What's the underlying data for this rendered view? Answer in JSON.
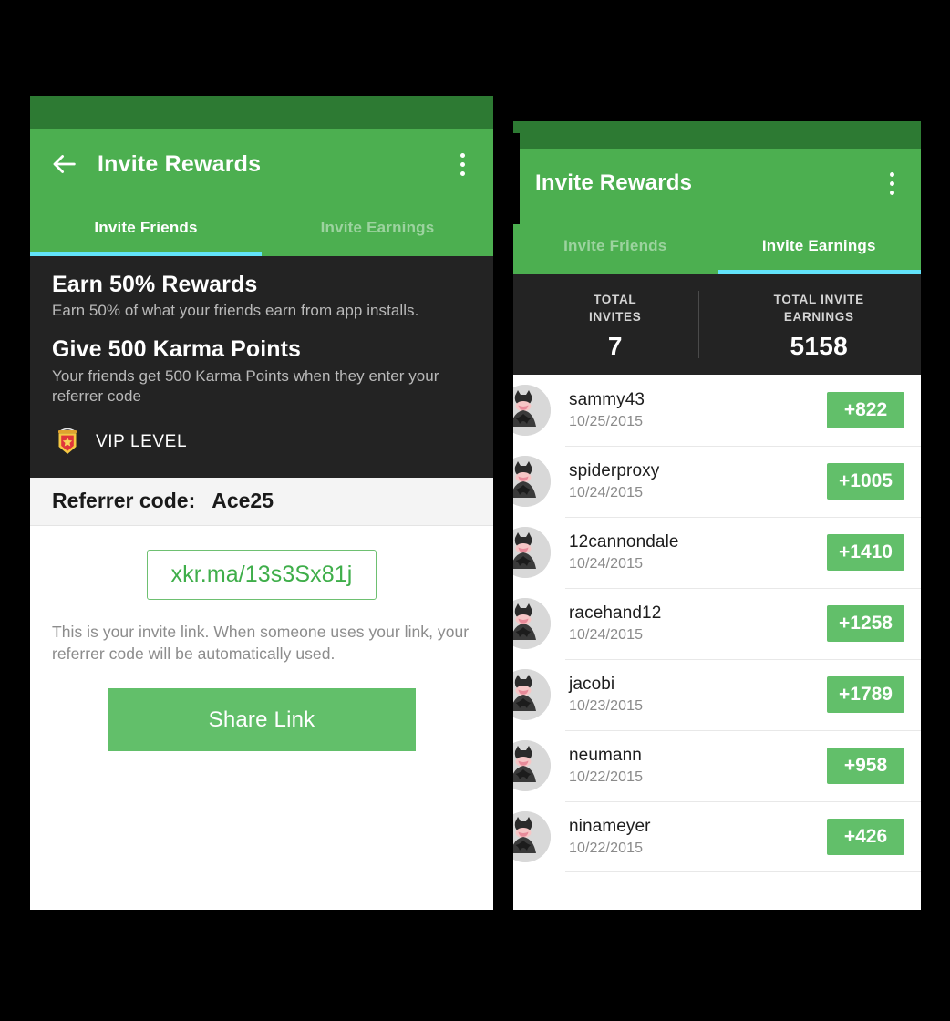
{
  "left_phone": {
    "appbar": {
      "back_icon": "arrow-left-icon",
      "title": "Invite Rewards",
      "overflow_icon": "overflow-menu-icon"
    },
    "tabs": [
      {
        "label": "Invite Friends",
        "active": true
      },
      {
        "label": "Invite Earnings",
        "active": false
      }
    ],
    "promo": {
      "heading_1": "Earn 50% Rewards",
      "body_1": "Earn 50% of what your friends earn from app installs.",
      "heading_2": "Give 500 Karma Points",
      "body_2": "Your friends get 500 Karma Points when they enter your referrer code",
      "vip_icon": "vip-badge-icon",
      "vip_label": "VIP LEVEL"
    },
    "referrer": {
      "label": "Referrer code:",
      "value": "Ace25"
    },
    "invite_link": "xkr.ma/13s3Sx81j",
    "link_note": "This is your invite link. When someone uses your link, your referrer code will be automatically used.",
    "share_button": "Share Link"
  },
  "right_phone": {
    "appbar": {
      "title": "Invite Rewards",
      "overflow_icon": "overflow-menu-icon"
    },
    "tabs": [
      {
        "label": "Invite Friends",
        "active": false
      },
      {
        "label": "Invite Earnings",
        "active": true
      }
    ],
    "stats": [
      {
        "label": "TOTAL\nINVITES",
        "label_line1": "TOTAL",
        "label_line2": "INVITES",
        "value": "7"
      },
      {
        "label": "TOTAL INVITE\nEARNINGS",
        "label_line1": "TOTAL INVITE",
        "label_line2": "EARNINGS",
        "value": "5158"
      }
    ],
    "earnings": [
      {
        "avatar": "batman-avatar-icon",
        "name": "sammy43",
        "date": "10/25/2015",
        "amount": "+822"
      },
      {
        "avatar": "batman-avatar-icon",
        "name": "spiderproxy",
        "date": "10/24/2015",
        "amount": "+1005"
      },
      {
        "avatar": "batman-avatar-icon",
        "name": "12cannondale",
        "date": "10/24/2015",
        "amount": "+1410"
      },
      {
        "avatar": "batman-avatar-icon",
        "name": "racehand12",
        "date": "10/24/2015",
        "amount": "+1258"
      },
      {
        "avatar": "batman-avatar-icon",
        "name": "jacobi",
        "date": "10/23/2015",
        "amount": "+1789"
      },
      {
        "avatar": "batman-avatar-icon",
        "name": "neumann",
        "date": "10/22/2015",
        "amount": "+958"
      },
      {
        "avatar": "batman-avatar-icon",
        "name": "ninameyer",
        "date": "10/22/2015",
        "amount": "+426"
      }
    ]
  },
  "colors": {
    "status_bar": "#2d7a33",
    "app_bar": "#4caf50",
    "tab_indicator": "#62e3fa",
    "dark_panel": "#232323",
    "accent_green": "#62bf6a",
    "link_green": "#3fae4a",
    "page_background": "#000000"
  }
}
